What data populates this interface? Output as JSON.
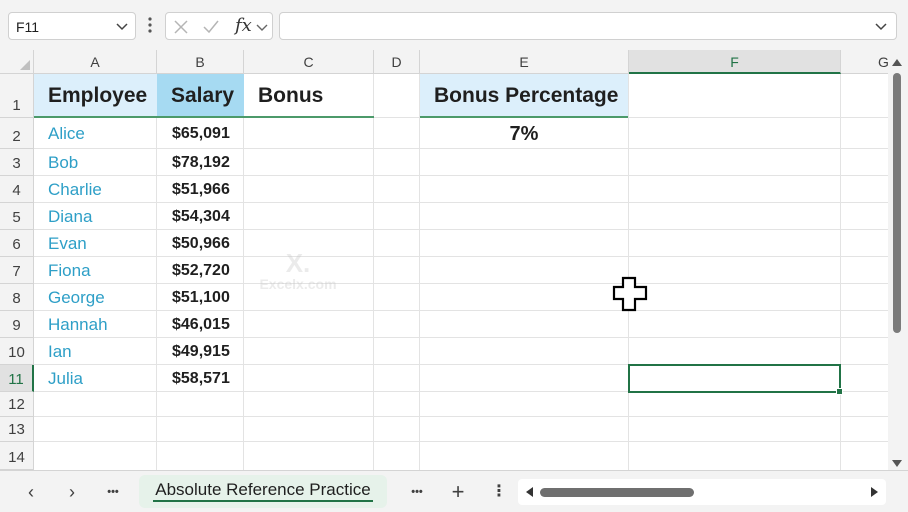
{
  "formula_bar": {
    "name_box": "F11",
    "fx_label": "fx",
    "formula_value": ""
  },
  "columns": [
    "A",
    "B",
    "C",
    "D",
    "E",
    "F",
    "G"
  ],
  "rows": [
    "1",
    "2",
    "3",
    "4",
    "5",
    "6",
    "7",
    "8",
    "9",
    "10",
    "11",
    "12",
    "13",
    "14"
  ],
  "headers": {
    "employee": "Employee",
    "salary": "Salary",
    "bonus": "Bonus",
    "bonus_percentage": "Bonus Percentage"
  },
  "bonus_percentage_value": "7%",
  "employees": [
    {
      "name": "Alice",
      "salary": "$65,091"
    },
    {
      "name": "Bob",
      "salary": "$78,192"
    },
    {
      "name": "Charlie",
      "salary": "$51,966"
    },
    {
      "name": "Diana",
      "salary": "$54,304"
    },
    {
      "name": "Evan",
      "salary": "$50,966"
    },
    {
      "name": "Fiona",
      "salary": "$52,720"
    },
    {
      "name": "George",
      "salary": "$51,100"
    },
    {
      "name": "Hannah",
      "salary": "$46,015"
    },
    {
      "name": "Ian",
      "salary": "$49,915"
    },
    {
      "name": "Julia",
      "salary": "$58,571"
    }
  ],
  "watermark": {
    "mark": "X.",
    "text": "Excelx.com"
  },
  "sheet_tabs": {
    "active": "Absolute Reference Practice",
    "prev_icon": "‹",
    "next_icon": "›",
    "more_icon": "•••",
    "more_sheets_icon": "•••",
    "add_icon": "+",
    "options_icon": "⋮"
  },
  "colors": {
    "accent": "#217346",
    "header_fill": "#dceffb",
    "salary_header_fill": "#a6daf2",
    "name_text": "#2e9fc7"
  },
  "selected_cell": "F11"
}
